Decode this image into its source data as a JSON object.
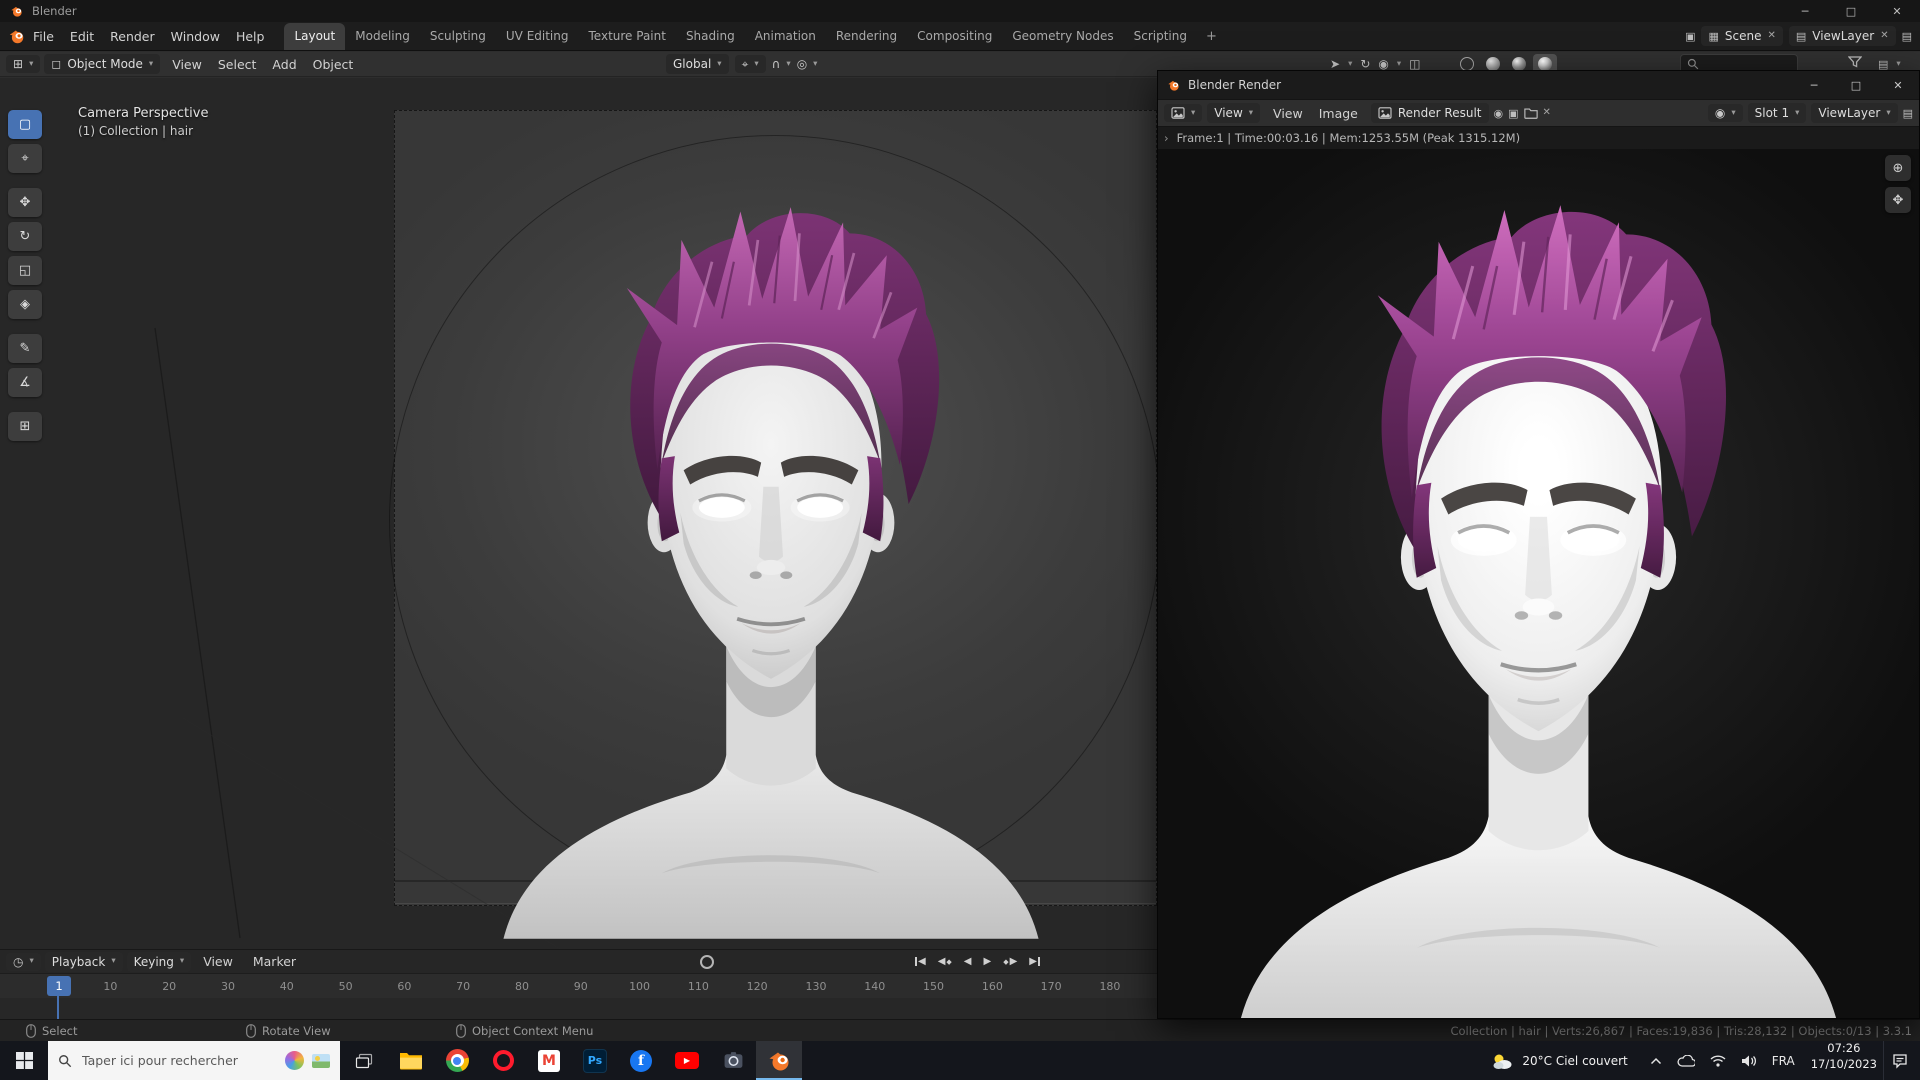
{
  "window": {
    "title": "Blender"
  },
  "topbar": {
    "menus": [
      "File",
      "Edit",
      "Render",
      "Window",
      "Help"
    ],
    "workspaces": [
      "Layout",
      "Modeling",
      "Sculpting",
      "UV Editing",
      "Texture Paint",
      "Shading",
      "Animation",
      "Rendering",
      "Compositing",
      "Geometry Nodes",
      "Scripting"
    ],
    "active_workspace": "Layout",
    "add_workspace_label": "+",
    "scene_label": "Scene",
    "viewlayer_label": "ViewLayer"
  },
  "viewport_header": {
    "mode_label": "Object Mode",
    "menus": [
      "View",
      "Select",
      "Add",
      "Object"
    ],
    "orientation_label": "Global"
  },
  "viewport": {
    "view_name": "Camera Perspective",
    "collection_info": "(1) Collection | hair"
  },
  "render_window": {
    "title": "Blender Render",
    "view_dropdown_label": "View",
    "menus": [
      "View",
      "Image"
    ],
    "image_name": "Render Result",
    "slot_label": "Slot 1",
    "viewlayer_label": "ViewLayer",
    "stats_line": "Frame:1 | Time:00:03.16 | Mem:1253.55M (Peak 1315.12M)"
  },
  "timeline": {
    "menus": [
      "Playback",
      "Keying",
      "View",
      "Marker"
    ],
    "current_frame": "1",
    "ticks": [
      "10",
      "20",
      "30",
      "40",
      "50",
      "60",
      "70",
      "80",
      "90",
      "100",
      "110",
      "120",
      "130",
      "140",
      "150",
      "160",
      "170",
      "180"
    ]
  },
  "statusbar": {
    "hints": [
      "Select",
      "Rotate View",
      "Object Context Menu"
    ],
    "scene_stats": "Collection | hair | Verts:26,867 | Faces:19,836 | Tris:28,132 | Objects:0/13 | 3.3.1"
  },
  "taskbar": {
    "search_placeholder": "Taper ici pour rechercher",
    "weather_label": "20°C Ciel couvert",
    "language_label": "FRA",
    "time_label": "07:26",
    "date_label": "17/10/2023"
  },
  "icons": {
    "caret_down": "▾",
    "editor_grid": "⊞",
    "mode_cube": "◻",
    "pivot": "⌖",
    "magnet": "∩",
    "proportional": "◎",
    "gizmo": "↻",
    "overlays": "◉",
    "xray": "◫",
    "pointer": "➤",
    "minimize": "─",
    "maximize": "□",
    "close": "✕",
    "play": "▶",
    "play_reverse": "◀",
    "keyframe": "◆",
    "expand_arrow": "›",
    "scene": "▦",
    "viewlayer": "▤",
    "new_item": "▣",
    "unlink": "✕",
    "pin": "◉",
    "clock": "◷",
    "zoom": "⊕",
    "hand": "✥",
    "tools": {
      "select": "▢",
      "cursor": "⌖",
      "move": "✥",
      "rotate": "↻",
      "scale": "◱",
      "transform": "◈",
      "annotate": "✎",
      "measure": "∡",
      "add_cube": "⊞"
    }
  },
  "colors": {
    "accent_blue": "#4772b3",
    "blender_orange": "#f5792a",
    "hair_purple": "#8f3f85"
  }
}
